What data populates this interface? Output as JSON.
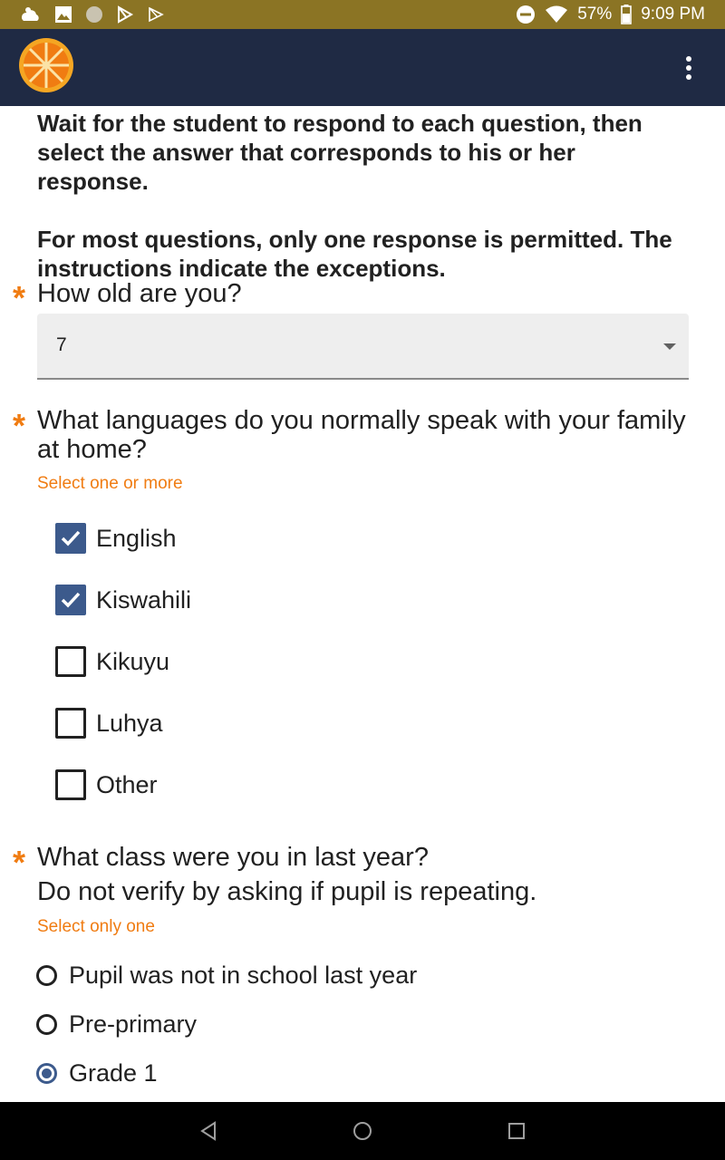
{
  "status_bar": {
    "battery_percent": "57%",
    "time": "9:09 PM",
    "left_icons": [
      "weather-icon",
      "image-icon",
      "circle-icon",
      "play-store-icon",
      "play-store-outline-icon"
    ],
    "right_icons": [
      "do-not-disturb-icon",
      "wifi-icon",
      "battery-icon"
    ]
  },
  "app_bar": {
    "logo_icon": "orange-slice-logo",
    "menu_icon": "more-vert-icon",
    "background": "#1f2a44"
  },
  "instructions": {
    "paragraph1": "Wait for the student to respond to each question, then select the answer that corresponds to his or her response.",
    "paragraph2": "For most questions, only one response is permitted. The instructions indicate the exceptions."
  },
  "q_age": {
    "required_marker": "*",
    "label": "How old are you?",
    "selected_value": "7"
  },
  "q_languages": {
    "required_marker": "*",
    "label": "What languages do you normally speak with your family at home?",
    "hint": "Select one or more",
    "options": [
      {
        "label": "English",
        "checked": true
      },
      {
        "label": "Kiswahili",
        "checked": true
      },
      {
        "label": "Kikuyu",
        "checked": false
      },
      {
        "label": "Luhya",
        "checked": false
      },
      {
        "label": "Other",
        "checked": false
      }
    ]
  },
  "q_class": {
    "required_marker": "*",
    "label_line1": "What class were you in last year?",
    "label_line2": "Do not verify by asking if pupil is repeating.",
    "hint": "Select only one",
    "options": [
      {
        "label": "Pupil was not in school last year",
        "selected": false
      },
      {
        "label": "Pre-primary",
        "selected": false
      },
      {
        "label": "Grade 1",
        "selected": true
      }
    ]
  },
  "nav_bar": {
    "icons": [
      "back-icon",
      "home-icon",
      "recents-icon"
    ]
  },
  "colors": {
    "status_bar": "#8b7424",
    "accent_orange": "#f07c12",
    "control_blue": "#3c5a8c"
  }
}
